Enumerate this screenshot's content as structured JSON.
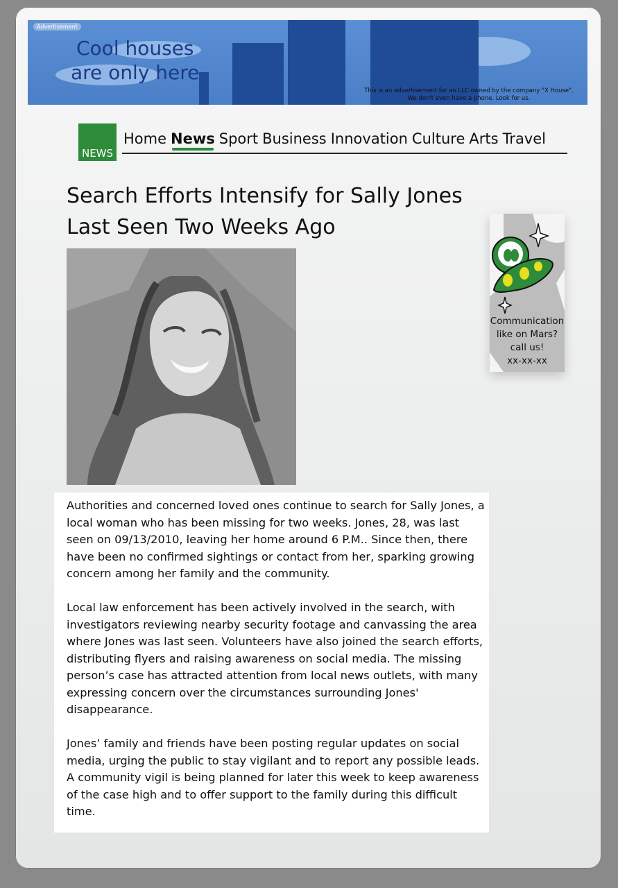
{
  "banner_ad": {
    "tag": "Advertisement",
    "headline_1": "Cool houses",
    "headline_2": "are only here",
    "note_1": "This is an advertisement for an LLC owned by the company \"X House\".",
    "note_2": "We don't even have a phone. Look for us.",
    "colors": {
      "sky": "#4a7fc7",
      "buildings": "#1f4b97",
      "text": "#1c3a86"
    }
  },
  "nav": {
    "logo_text": "NEWS",
    "items": [
      "Home",
      "News",
      "Sport",
      "Business",
      "Innovation",
      "Culture",
      "Arts",
      "Travel"
    ],
    "active": "News",
    "accent_color": "#2e8b3a"
  },
  "article": {
    "headline_1": "Search Efforts Intensify for Sally Jones",
    "headline_2": "Last Seen Two Weeks Ago",
    "paragraphs": [
      "Authorities and concerned loved ones continue to search for Sally Jones, a local woman who has been missing for two weeks. Jones, 28, was last seen on 09/13/2010, leaving her home around 6 P.M.. Since then, there have been no confirmed sightings or contact from her, sparking growing concern among her family and the community.",
      "Local law enforcement has been actively involved in the search, with investigators reviewing nearby security footage and canvassing the area where Jones was last seen. Volunteers have also joined the search efforts, distributing flyers and raising awareness on social media. The missing person’s case has attracted attention from local news outlets, with many expressing concern over the circumstances surrounding Jones' disappearance.",
      "Jones’ family and friends have been posting regular updates on social media, urging the public to stay vigilant and to report any possible leads. A community vigil is being planned for later this week to keep awareness of the case high and to offer support to the family during this difficult time."
    ]
  },
  "side_ad": {
    "line_1": "Communication",
    "line_2": "like on Mars?",
    "line_3": "call us!",
    "line_4": "xx-xx-xx",
    "icon": "alien-ufo-icon"
  }
}
